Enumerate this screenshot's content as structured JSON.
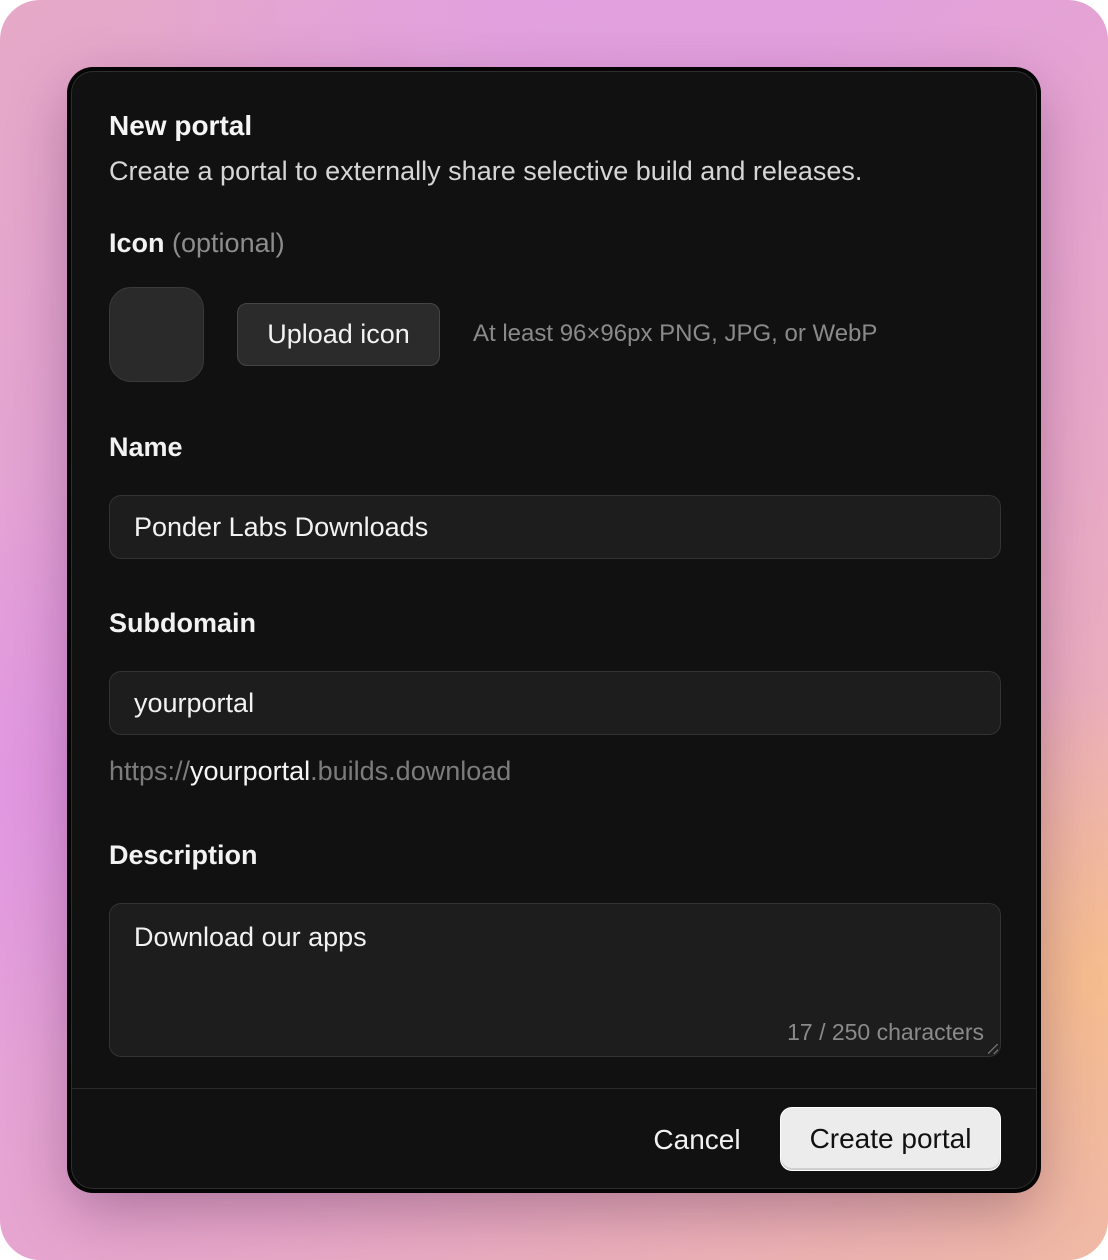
{
  "dialog": {
    "title": "New portal",
    "subtitle": "Create a portal to externally share selective build and releases."
  },
  "icon_section": {
    "label": "Icon",
    "optional": "(optional)",
    "upload_button": "Upload icon",
    "hint": "At least 96×96px PNG, JPG, or WebP"
  },
  "name_field": {
    "label": "Name",
    "value": "Ponder Labs Downloads"
  },
  "subdomain_field": {
    "label": "Subdomain",
    "value": "yourportal",
    "url_prefix": "https://",
    "url_subdomain": "yourportal",
    "url_suffix": ".builds.download"
  },
  "description_field": {
    "label": "Description",
    "value": "Download our apps",
    "char_count": "17 / 250 characters"
  },
  "footer": {
    "cancel_label": "Cancel",
    "create_label": "Create portal"
  },
  "colors": {
    "dialog_bg": "#111111",
    "field_bg": "#1d1d1d",
    "primary_button_bg": "#ececec"
  }
}
